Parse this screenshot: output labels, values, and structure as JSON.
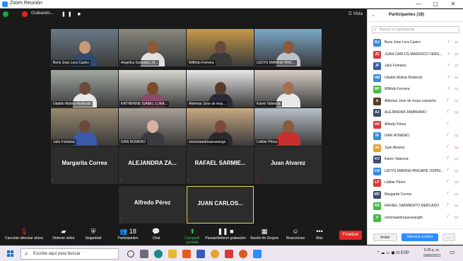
{
  "window": {
    "title": "Zoom Reunión",
    "min": "—",
    "max": "▢",
    "close": "✕"
  },
  "meeting": {
    "recording_label": "Grabando...",
    "recording_controls": "❚❚ ■",
    "view_label": "☷ Vista"
  },
  "tiles": [
    {
      "name": "Boris Jose Lora Castro",
      "type": "video",
      "bg": "#6a7a88",
      "skin": "#c79a7a",
      "shirt": "#2f4a6b"
    },
    {
      "name": "Angelica Gonzalez Jir...",
      "type": "video",
      "bg": "#8a8a80",
      "skin": "#8a5a3a",
      "shirt": "#e0e0e0"
    },
    {
      "name": "Wilfrido Ferreira",
      "type": "video",
      "bg": "#c79a4a",
      "skin": "#6a4a3a",
      "shirt": "#3a3a3a"
    },
    {
      "name": "LEDYS MARINA HINC...",
      "type": "video",
      "bg": "#7aa8c8",
      "skin": "#8a5a3a",
      "shirt": "#c0c0c8"
    },
    {
      "name": "Ubaldo Molina Redondo",
      "type": "video",
      "bg": "#a0a8a0",
      "skin": "#6a4a3a",
      "shirt": "#e8e8e8"
    },
    {
      "name": "KATHERINE ISABEL LUNA...",
      "type": "video",
      "bg": "#d8d8d0",
      "skin": "#7a4a2a",
      "shirt": "#8a4a6a"
    },
    {
      "name": "Aldemar Jose de moy...",
      "type": "video",
      "bg": "#e8e8e8",
      "skin": "#5a3a2a",
      "shirt": "#2a2a3a"
    },
    {
      "name": "Karen Valencia",
      "type": "video",
      "bg": "#d8d0c8",
      "skin": "#a07050",
      "shirt": "#e8e8e8"
    },
    {
      "name": "Julio Fontalvo",
      "type": "video",
      "bg": "#9a8a70",
      "skin": "#6a4a3a",
      "shirt": "#3a5aa8"
    },
    {
      "name": "IVAN ROMERO",
      "type": "video",
      "bg": "#a8a098",
      "skin": "#d8b0a0",
      "shirt": "#3a3a40"
    },
    {
      "name": "victoriaandreaaranango",
      "type": "video",
      "bg": "#c8a880",
      "skin": "#7a4a3a",
      "shirt": "#2a2a30"
    },
    {
      "name": "Liddier Pérez",
      "type": "video",
      "bg": "#b8c0c8",
      "skin": "#8a5a3a",
      "shirt": "#c83030"
    },
    {
      "name": "Margarita Correa",
      "type": "name"
    },
    {
      "name": "ALEJANDRA ZA...",
      "type": "name"
    },
    {
      "name": "RAFAEL SARMIE...",
      "type": "name"
    },
    {
      "name": "Juan Alvarez",
      "type": "name"
    },
    {
      "name": "Alfredo Pérez",
      "type": "name"
    },
    {
      "name": "JUAN CARLOS...",
      "type": "name",
      "active": true
    }
  ],
  "toolbar": {
    "items": [
      {
        "label": "Cancelar silenciar ahora",
        "icon": "🎙",
        "name": "unmute-button"
      },
      {
        "label": "Detener video",
        "icon": "▰",
        "name": "stop-video-button"
      },
      {
        "label": "Seguridad",
        "icon": "⛨",
        "name": "security-button"
      },
      {
        "label": "Participantes",
        "icon": "👥 18",
        "name": "participants-button"
      },
      {
        "label": "Chat",
        "icon": "💬",
        "name": "chat-button"
      },
      {
        "label": "Compartir pantalla",
        "icon": "⬆",
        "name": "share-screen-button"
      },
      {
        "label": "Pausar/detener grabación",
        "icon": "❚❚ ■",
        "name": "pause-recording-button"
      },
      {
        "label": "Sesión de Grupos",
        "icon": "▦",
        "name": "breakout-button"
      },
      {
        "label": "Reacciones",
        "icon": "☺",
        "name": "reactions-button"
      },
      {
        "label": "Más",
        "icon": "•••",
        "name": "more-button"
      }
    ],
    "end_label": "Finalizar"
  },
  "panel": {
    "title": "Participantes (18)",
    "search_placeholder": "Buscar un participante",
    "participants": [
      {
        "initials": "BJ",
        "name": "Boris Jose Lora Castro",
        "color": "#3a8ad8",
        "mic": "on",
        "cam": "on"
      },
      {
        "initials": "JC",
        "name": "JUAN CARLOS MARENCO VERG...",
        "color": "#d83a3a",
        "mic": "on",
        "cam": "off"
      },
      {
        "initials": "JF",
        "name": "Julio Fontalvo",
        "color": "#3a5aa8",
        "mic": "on",
        "cam": "on"
      },
      {
        "initials": "UM",
        "name": "Ubaldo Molina Redondo",
        "color": "#3a8ad8",
        "mic": "on",
        "cam": "on"
      },
      {
        "initials": "WF",
        "name": "Wilfrido Ferreira",
        "color": "#48b848",
        "mic": "on",
        "cam": "on"
      },
      {
        "initials": "A",
        "name": "Aldemar Jose de moya camacho",
        "color": "#5a3a2a",
        "mic": "off",
        "cam": "on"
      },
      {
        "initials": "AZ",
        "name": "ALEJANDRA ZAMBRANO",
        "color": "#3a4a68",
        "mic": "off",
        "cam": "off"
      },
      {
        "initials": "AP",
        "name": "Alfredo Pérez",
        "color": "#d83a3a",
        "mic": "off",
        "cam": ""
      },
      {
        "initials": "IR",
        "name": "IVAN ROMERO",
        "color": "#3a8ad8",
        "mic": "off",
        "cam": "on"
      },
      {
        "initials": "JA",
        "name": "Juan Alvarez",
        "color": "#e8a030",
        "mic": "off",
        "cam": "off"
      },
      {
        "initials": "KV",
        "name": "Karen Valencia",
        "color": "#3a4a68",
        "mic": "off",
        "cam": "on"
      },
      {
        "initials": "LM",
        "name": "LEDYS MARINA HINCAPIE OSPIN...",
        "color": "#3a8ad8",
        "mic": "off",
        "cam": "on"
      },
      {
        "initials": "LP",
        "name": "Liddier Pérez",
        "color": "#d83a3a",
        "mic": "off",
        "cam": "on"
      },
      {
        "initials": "MC",
        "name": "Margarita Correa",
        "color": "#3a4a68",
        "mic": "off",
        "cam": "off"
      },
      {
        "initials": "RS",
        "name": "RAFAEL SARMIENTO MERCADO",
        "color": "#48b848",
        "mic": "off",
        "cam": "off"
      },
      {
        "initials": "V",
        "name": "victoriaandreaaranangfo",
        "color": "#48b848",
        "mic": "off",
        "cam": "on"
      }
    ],
    "invite_label": "Invitar",
    "mute_all_label": "Silenciar a todos",
    "more_label": "..."
  },
  "taskbar": {
    "search_text": "Escribe aquí para buscar",
    "tray_text": "^ ☁ ▭ ◼ ⊡ ESP",
    "time": "5:35 p. m.",
    "date": "19/05/2021"
  }
}
